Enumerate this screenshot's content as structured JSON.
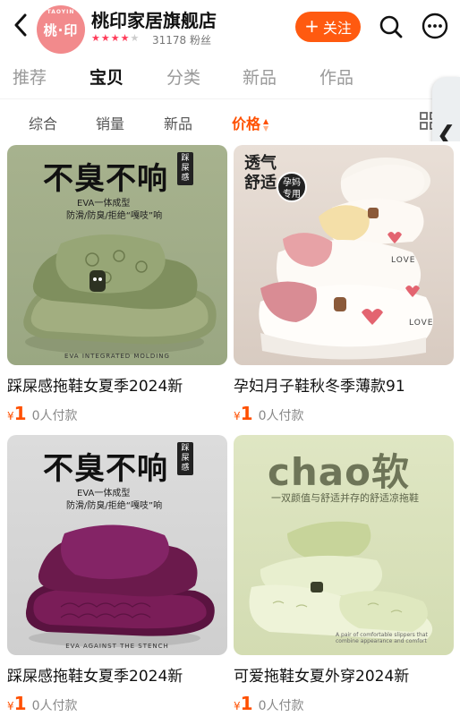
{
  "header": {
    "back_icon": "chevron-left-icon",
    "logo_text": "桃·印",
    "logo_arc_text": "TAOYIN",
    "store_name": "桃印家居旗舰店",
    "rating_stars": 4,
    "rating_max": 5,
    "fans_text": "31178 粉丝",
    "follow_plus": "+",
    "follow_label": "关注",
    "search_icon": "search-icon",
    "more_icon": "more-icon"
  },
  "tabs": [
    {
      "label": "推荐",
      "active": false
    },
    {
      "label": "宝贝",
      "active": true
    },
    {
      "label": "分类",
      "active": false
    },
    {
      "label": "新品",
      "active": false
    },
    {
      "label": "作品",
      "active": false
    }
  ],
  "sort": [
    {
      "label": "综合",
      "active": false
    },
    {
      "label": "销量",
      "active": false
    },
    {
      "label": "新品",
      "active": false
    },
    {
      "label": "价格",
      "active": true,
      "arrow_up": "▲",
      "arrow_down": "▼"
    }
  ],
  "side_handle_glyph": "❮",
  "colors": {
    "accent": "#ff5000",
    "follow_bg": "#ff5a10",
    "logo_bg": "#f28a8c"
  },
  "products": [
    {
      "title": "踩屎感拖鞋女夏季2024新",
      "currency": "¥",
      "price": "1",
      "sales": "0人付款",
      "image": {
        "slogan": "不臭不响",
        "side_tag": "踩屎感",
        "line1": "EVA一体成型",
        "line2": "防滑/防臭/拒绝“嘎吱”响",
        "caption": "EVA INTEGRATED MOLDING"
      }
    },
    {
      "title": "孕妇月子鞋秋冬季薄款91",
      "currency": "¥",
      "price": "1",
      "sales": "0人付款",
      "image": {
        "label_line1": "透气",
        "label_line2": "舒适",
        "badge_line1": "孕妈",
        "badge_line2": "专用",
        "love1": "LOVE",
        "love2": "LOVE"
      }
    },
    {
      "title": "踩屎感拖鞋女夏季2024新",
      "currency": "¥",
      "price": "1",
      "sales": "0人付款",
      "image": {
        "slogan": "不臭不响",
        "side_tag": "踩屎感",
        "line1": "EVA一体成型",
        "line2": "防滑/防臭/拒绝“嘎吱”响",
        "caption": "EVA AGAINST THE STENCH"
      }
    },
    {
      "title": "可爱拖鞋女夏外穿2024新",
      "currency": "¥",
      "price": "1",
      "sales": "0人付款",
      "image": {
        "headline": "chao软",
        "sub": "一双颜值与舒适并存的舒适凉拖鞋",
        "note": "A pair of comfortable slippers that combine appearance and comfort"
      }
    }
  ]
}
